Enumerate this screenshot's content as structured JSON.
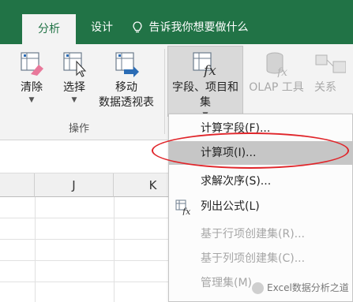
{
  "tabs": {
    "analyze": "分析",
    "design": "设计"
  },
  "tell_me": "告诉我你想要做什么",
  "ribbon": {
    "clear": "清除",
    "select": "选择",
    "move_line1": "移动",
    "move_line2": "数据透视表",
    "actions_group": "操作",
    "fields_line1": "字段、项目和",
    "fields_line2": "集",
    "olap": "OLAP 工具",
    "relations": "关系"
  },
  "columns": [
    "J",
    "K"
  ],
  "menu": {
    "items": [
      {
        "label": "计算字段(F)...",
        "enabled": true
      },
      {
        "label": "计算项(I)...",
        "enabled": true,
        "highlighted": true
      },
      {
        "label": "求解次序(S)...",
        "enabled": true
      },
      {
        "label": "列出公式(L)",
        "enabled": true
      },
      {
        "label": "基于行项创建集(R)...",
        "enabled": false
      },
      {
        "label": "基于列项创建集(C)...",
        "enabled": false
      },
      {
        "label": "管理集(M)...",
        "enabled": false
      }
    ]
  },
  "watermark": "Excel数据分析之道",
  "colors": {
    "ribbon_green": "#217346",
    "highlight": "#c6c6c6",
    "annotation_red": "#e0252a"
  }
}
